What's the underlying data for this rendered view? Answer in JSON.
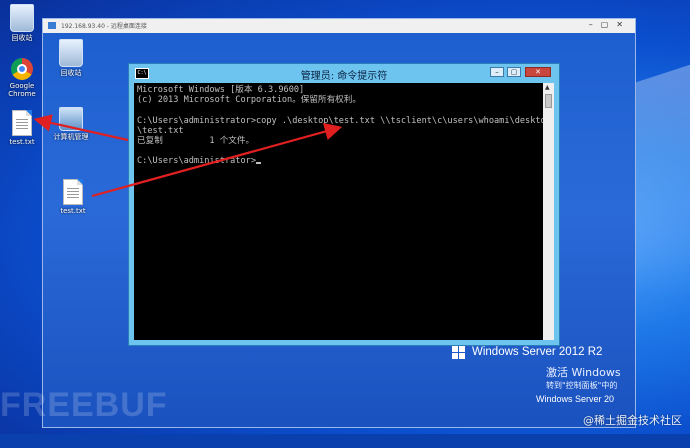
{
  "desktop": {
    "icons": [
      {
        "label": "回收站"
      },
      {
        "label": "Google Chrome"
      },
      {
        "label": "test.txt"
      }
    ]
  },
  "rdp": {
    "title": "192.168.93.40 - 远程桌面连接",
    "icons": [
      {
        "label": "回收站"
      },
      {
        "label": "计算机管理"
      },
      {
        "label": "test.txt"
      }
    ]
  },
  "cmd": {
    "title": "管理员: 命令提示符",
    "icon_text": "C:\\",
    "lines": [
      "Microsoft Windows [版本 6.3.9600]",
      "(c) 2013 Microsoft Corporation。保留所有权利。",
      "",
      "C:\\Users\\administrator>copy .\\desktop\\test.txt \\\\tsclient\\c\\users\\whoami\\desktop",
      "\\test.txt",
      "已复制         1 个文件。",
      "",
      "C:\\Users\\administrator>"
    ]
  },
  "server": {
    "logo_text": "Windows Server 2012 R2",
    "activate_title": "激活 Windows",
    "activate_hint": "转到\"控制面板\"中的",
    "bottom_text": "Windows Server 20"
  },
  "watermarks": {
    "freebuf": "FREEBUF",
    "juejin": "@稀土掘金技术社区"
  },
  "colors": {
    "annotation_red": "#e02020",
    "cmd_frame": "#6dc4ef",
    "console_bg": "#000000",
    "console_text": "#c0c0c0"
  }
}
